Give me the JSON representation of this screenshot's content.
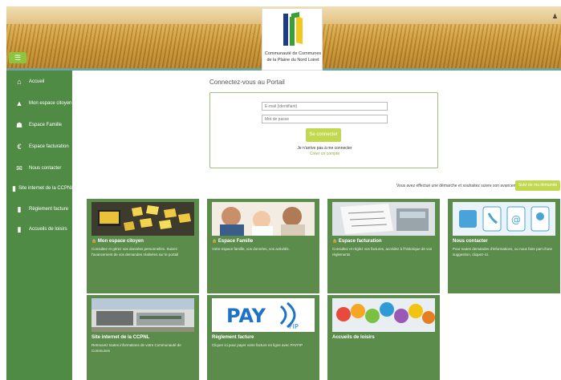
{
  "header": {
    "org_name_line1": "Communauté de Communes",
    "org_name_line2": "de la Plaine du Nord Loiret",
    "menu_icon": "hamburger-icon",
    "corner_icon": "user-icon"
  },
  "sidebar": {
    "items": [
      {
        "label": "Accueil",
        "icon": "home-icon",
        "glyph": "⌂"
      },
      {
        "label": "Mon espace citoyen",
        "icon": "person-icon",
        "glyph": "▲"
      },
      {
        "label": "Espace Famille",
        "icon": "family-icon",
        "glyph": "☗"
      },
      {
        "label": "Espace facturation",
        "icon": "euro-icon",
        "glyph": "€"
      },
      {
        "label": "Nous contacter",
        "icon": "envelope-icon",
        "glyph": "✉"
      },
      {
        "label": "Site internet de la CCPNL",
        "icon": "document-icon",
        "glyph": "▮"
      },
      {
        "label": "Règlement facture",
        "icon": "document-icon",
        "glyph": "▮"
      },
      {
        "label": "Accueils de loisirs",
        "icon": "document-icon",
        "glyph": "▮"
      }
    ]
  },
  "login": {
    "title": "Connectez-vous au Portail",
    "email_placeholder": "E-mail (identifiant)",
    "password_placeholder": "Mot de passe",
    "submit_label": "Se connecter",
    "forgot_label": "Je n'arrive pas à me connecter",
    "create_label": "Créer un compte"
  },
  "suivi": {
    "text": "Vous avez effectué une démarche et souhaitez suivre son avancement",
    "button_label": "Suivi de ma demande"
  },
  "cards": [
    {
      "title": "Mon espace citoyen",
      "locked": true,
      "desc": "Consultez et gérez vos données personnelles. Suivez l'avancement de vos demandes réalisées sur le portail"
    },
    {
      "title": "Espace Famille",
      "locked": true,
      "desc": "Votre espace famille, vos données, vos activités."
    },
    {
      "title": "Espace facturation",
      "locked": true,
      "desc": "Consultez et réglez vos factures, accédez à l'historique de vos règlements"
    },
    {
      "title": "Nous contacter",
      "locked": false,
      "desc": "Pour toutes demandes d'informations, ou nous faire part d'une suggestion, cliquez-ici."
    },
    {
      "title": "Site internet de la CCPNL",
      "locked": false,
      "desc": "Retrouvez toutes informations de votre Communauté de Communes"
    },
    {
      "title": "Règlement facture",
      "locked": false,
      "desc": "Cliquer ici pour payer votre facture en ligne avec PAYFIP"
    },
    {
      "title": "Accueils de loisirs",
      "locked": false,
      "desc": ""
    }
  ],
  "payfip": {
    "line1": "PAY",
    "line2": "FIP"
  },
  "colors": {
    "sidebar": "#4f8b45",
    "card": "#5b8c4c",
    "accent": "#c2d94f"
  }
}
